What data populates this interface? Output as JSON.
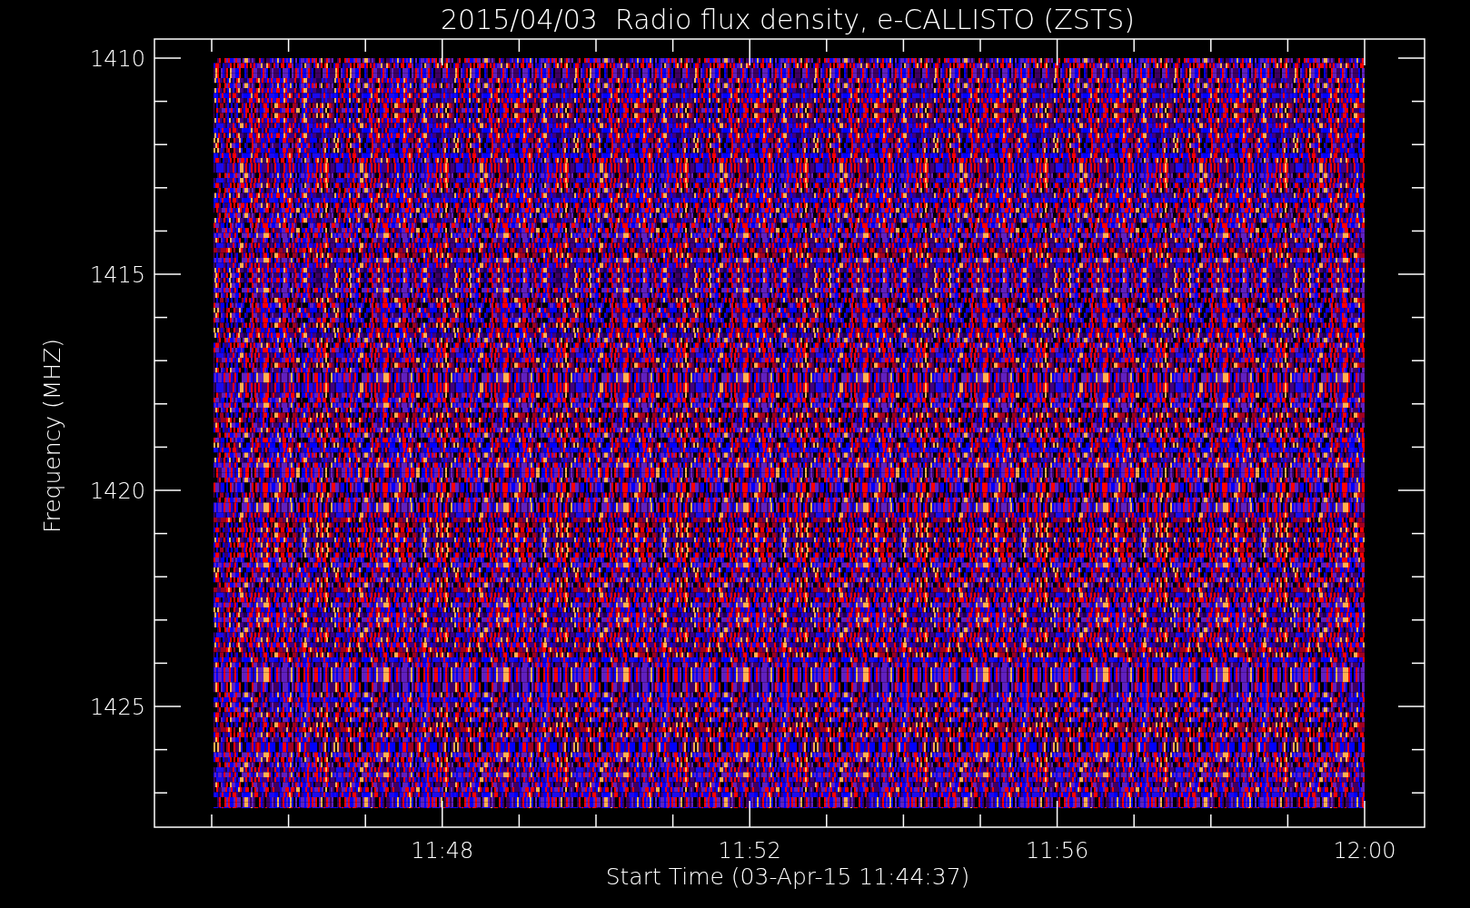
{
  "title": "2015/04/03  Radio flux density, e-CALLISTO (ZSTS)",
  "y_axis": {
    "label": "Frequency (MHZ)",
    "ticks": [
      "1410",
      "1415",
      "1420",
      "1425"
    ]
  },
  "x_axis": {
    "label": "Start Time (03-Apr-15 11:44:37)",
    "ticks": [
      "11:48",
      "11:52",
      "11:56",
      "12:00"
    ]
  }
}
